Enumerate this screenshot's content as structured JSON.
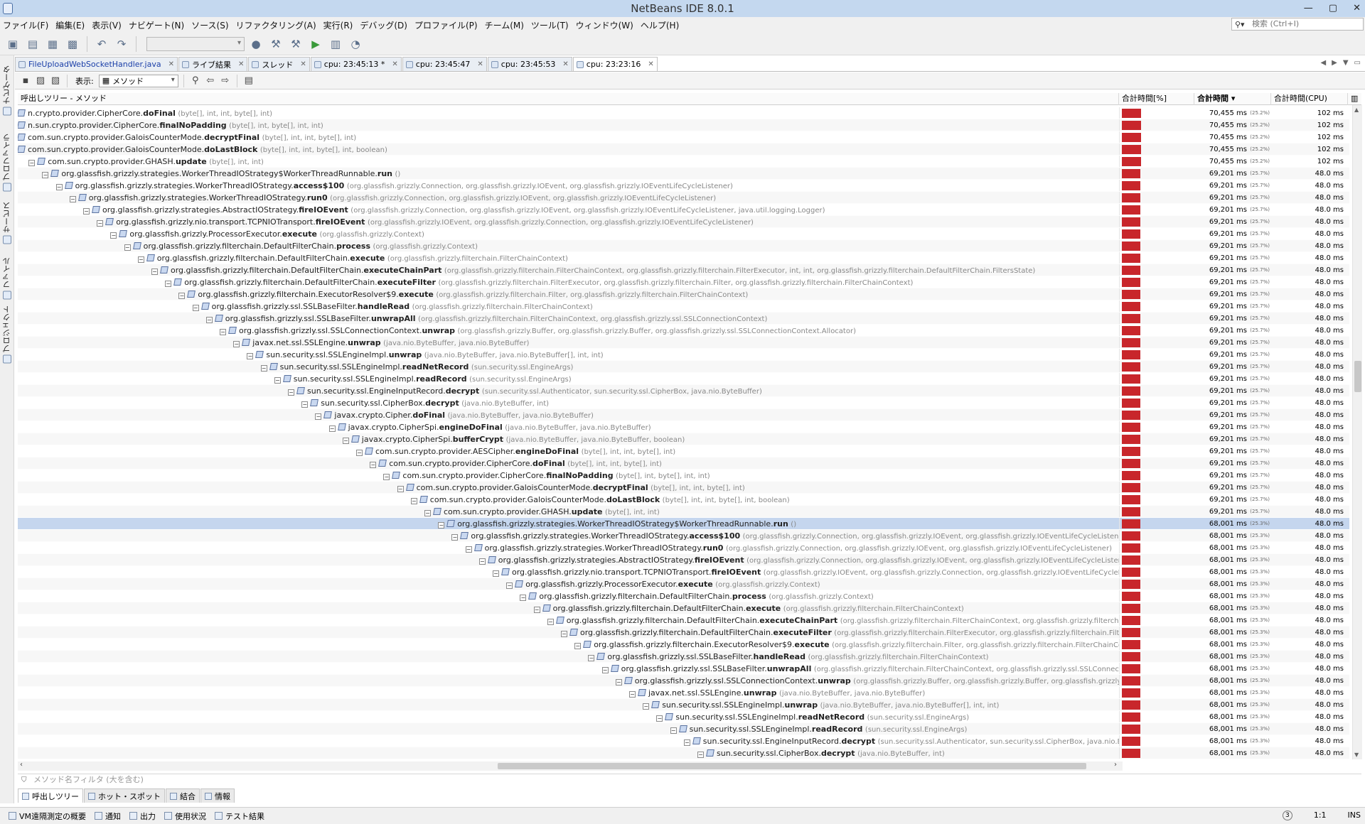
{
  "window": {
    "title": "NetBeans IDE 8.0.1",
    "controls": [
      "—",
      "▢",
      "✕"
    ]
  },
  "menu": [
    "ファイル(F)",
    "編集(E)",
    "表示(V)",
    "ナビゲート(N)",
    "ソース(S)",
    "リファクタリング(A)",
    "実行(R)",
    "デバッグ(D)",
    "プロファイル(P)",
    "チーム(M)",
    "ツール(T)",
    "ウィンドウ(W)",
    "ヘルプ(H)"
  ],
  "search": {
    "placeholder": "検索 (Ctrl+I)"
  },
  "left_sidebar": [
    "ナビゲータ",
    "プロファイラ",
    "サービス",
    "ファイル",
    "プロジェクト"
  ],
  "editor_tabs": [
    {
      "label": "FileUploadWebSocketHandler.java",
      "active": false
    },
    {
      "label": "ライブ結果",
      "active": false
    },
    {
      "label": "スレッド",
      "active": false
    },
    {
      "label": "cpu: 23:45:13 *",
      "active": false
    },
    {
      "label": "cpu: 23:45:47",
      "active": false
    },
    {
      "label": "cpu: 23:45:53",
      "active": false
    },
    {
      "label": "cpu: 23:23:16",
      "active": true
    }
  ],
  "profiler_toolbar": {
    "view_label": "表示:",
    "view_value": "メソッド"
  },
  "table": {
    "headers": [
      "呼出しツリー - メソッド",
      "合計時間[%]",
      "合計時間 ▾",
      "合計時間(CPU)"
    ],
    "rows": [
      {
        "depth": 0,
        "pre": "n.crypto.provider.CipherCore.",
        "m": "doFinal",
        "args": "(byte[], int, int, byte[], int)",
        "pct": 25.2,
        "time": "70,455 ms",
        "pctlabel": "(25.2%)",
        "cpu": "102 ms",
        "toggle": false
      },
      {
        "depth": 0,
        "pre": "n.sun.crypto.provider.CipherCore.",
        "m": "finalNoPadding",
        "args": "(byte[], int, byte[], int, int)",
        "pct": 25.2,
        "time": "70,455 ms",
        "pctlabel": "(25.2%)",
        "cpu": "102 ms",
        "toggle": false
      },
      {
        "depth": 0,
        "pre": "com.sun.crypto.provider.GaloisCounterMode.",
        "m": "decryptFinal",
        "args": "(byte[], int, int, byte[], int)",
        "pct": 25.2,
        "time": "70,455 ms",
        "pctlabel": "(25.2%)",
        "cpu": "102 ms",
        "toggle": false
      },
      {
        "depth": 0,
        "pre": "com.sun.crypto.provider.GaloisCounterMode.",
        "m": "doLastBlock",
        "args": "(byte[], int, int, byte[], int, boolean)",
        "pct": 25.2,
        "time": "70,455 ms",
        "pctlabel": "(25.2%)",
        "cpu": "102 ms",
        "toggle": false
      },
      {
        "depth": 1,
        "pre": "com.sun.crypto.provider.GHASH.",
        "m": "update",
        "args": "(byte[], int, int)",
        "pct": 25.2,
        "time": "70,455 ms",
        "pctlabel": "(25.2%)",
        "cpu": "102 ms",
        "toggle": true
      },
      {
        "depth": 2,
        "pre": "org.glassfish.grizzly.strategies.WorkerThreadIOStrategy$WorkerThreadRunnable.",
        "m": "run",
        "args": "()",
        "pct": 24.7,
        "time": "69,201 ms",
        "pctlabel": "(25.7%)",
        "cpu": "48.0 ms",
        "toggle": true
      },
      {
        "depth": 3,
        "pre": "org.glassfish.grizzly.strategies.WorkerThreadIOStrategy.",
        "m": "access$100",
        "args": "(org.glassfish.grizzly.Connection, org.glassfish.grizzly.IOEvent, org.glassfish.grizzly.IOEventLifeCycleListener)",
        "pct": 24.7,
        "time": "69,201 ms",
        "pctlabel": "(25.7%)",
        "cpu": "48.0 ms",
        "toggle": true
      },
      {
        "depth": 4,
        "pre": "org.glassfish.grizzly.strategies.WorkerThreadIOStrategy.",
        "m": "run0",
        "args": "(org.glassfish.grizzly.Connection, org.glassfish.grizzly.IOEvent, org.glassfish.grizzly.IOEventLifeCycleListener)",
        "pct": 24.7,
        "time": "69,201 ms",
        "pctlabel": "(25.7%)",
        "cpu": "48.0 ms",
        "toggle": true
      },
      {
        "depth": 5,
        "pre": "org.glassfish.grizzly.strategies.AbstractIOStrategy.",
        "m": "fireIOEvent",
        "args": "(org.glassfish.grizzly.Connection, org.glassfish.grizzly.IOEvent, org.glassfish.grizzly.IOEventLifeCycleListener, java.util.logging.Logger)",
        "pct": 24.7,
        "time": "69,201 ms",
        "pctlabel": "(25.7%)",
        "cpu": "48.0 ms",
        "toggle": true
      },
      {
        "depth": 6,
        "pre": "org.glassfish.grizzly.nio.transport.TCPNIOTransport.",
        "m": "fireIOEvent",
        "args": "(org.glassfish.grizzly.IOEvent, org.glassfish.grizzly.Connection, org.glassfish.grizzly.IOEventLifeCycleListener)",
        "pct": 24.7,
        "time": "69,201 ms",
        "pctlabel": "(25.7%)",
        "cpu": "48.0 ms",
        "toggle": true
      },
      {
        "depth": 7,
        "pre": "org.glassfish.grizzly.ProcessorExecutor.",
        "m": "execute",
        "args": "(org.glassfish.grizzly.Context)",
        "pct": 24.7,
        "time": "69,201 ms",
        "pctlabel": "(25.7%)",
        "cpu": "48.0 ms",
        "toggle": true
      },
      {
        "depth": 8,
        "pre": "org.glassfish.grizzly.filterchain.DefaultFilterChain.",
        "m": "process",
        "args": "(org.glassfish.grizzly.Context)",
        "pct": 24.7,
        "time": "69,201 ms",
        "pctlabel": "(25.7%)",
        "cpu": "48.0 ms",
        "toggle": true
      },
      {
        "depth": 9,
        "pre": "org.glassfish.grizzly.filterchain.DefaultFilterChain.",
        "m": "execute",
        "args": "(org.glassfish.grizzly.filterchain.FilterChainContext)",
        "pct": 24.7,
        "time": "69,201 ms",
        "pctlabel": "(25.7%)",
        "cpu": "48.0 ms",
        "toggle": true
      },
      {
        "depth": 10,
        "pre": "org.glassfish.grizzly.filterchain.DefaultFilterChain.",
        "m": "executeChainPart",
        "args": "(org.glassfish.grizzly.filterchain.FilterChainContext, org.glassfish.grizzly.filterchain.FilterExecutor, int, int, org.glassfish.grizzly.filterchain.DefaultFilterChain.FiltersState)",
        "pct": 24.7,
        "time": "69,201 ms",
        "pctlabel": "(25.7%)",
        "cpu": "48.0 ms",
        "toggle": true
      },
      {
        "depth": 11,
        "pre": "org.glassfish.grizzly.filterchain.DefaultFilterChain.",
        "m": "executeFilter",
        "args": "(org.glassfish.grizzly.filterchain.FilterExecutor, org.glassfish.grizzly.filterchain.Filter, org.glassfish.grizzly.filterchain.FilterChainContext)",
        "pct": 24.7,
        "time": "69,201 ms",
        "pctlabel": "(25.7%)",
        "cpu": "48.0 ms",
        "toggle": true
      },
      {
        "depth": 12,
        "pre": "org.glassfish.grizzly.filterchain.ExecutorResolver$9.",
        "m": "execute",
        "args": "(org.glassfish.grizzly.filterchain.Filter, org.glassfish.grizzly.filterchain.FilterChainContext)",
        "pct": 24.7,
        "time": "69,201 ms",
        "pctlabel": "(25.7%)",
        "cpu": "48.0 ms",
        "toggle": true
      },
      {
        "depth": 13,
        "pre": "org.glassfish.grizzly.ssl.SSLBaseFilter.",
        "m": "handleRead",
        "args": "(org.glassfish.grizzly.filterchain.FilterChainContext)",
        "pct": 24.7,
        "time": "69,201 ms",
        "pctlabel": "(25.7%)",
        "cpu": "48.0 ms",
        "toggle": true
      },
      {
        "depth": 14,
        "pre": "org.glassfish.grizzly.ssl.SSLBaseFilter.",
        "m": "unwrapAll",
        "args": "(org.glassfish.grizzly.filterchain.FilterChainContext, org.glassfish.grizzly.ssl.SSLConnectionContext)",
        "pct": 24.7,
        "time": "69,201 ms",
        "pctlabel": "(25.7%)",
        "cpu": "48.0 ms",
        "toggle": true
      },
      {
        "depth": 15,
        "pre": "org.glassfish.grizzly.ssl.SSLConnectionContext.",
        "m": "unwrap",
        "args": "(org.glassfish.grizzly.Buffer, org.glassfish.grizzly.Buffer, org.glassfish.grizzly.ssl.SSLConnectionContext.Allocator)",
        "pct": 24.7,
        "time": "69,201 ms",
        "pctlabel": "(25.7%)",
        "cpu": "48.0 ms",
        "toggle": true
      },
      {
        "depth": 16,
        "pre": "javax.net.ssl.SSLEngine.",
        "m": "unwrap",
        "args": "(java.nio.ByteBuffer, java.nio.ByteBuffer)",
        "pct": 24.7,
        "time": "69,201 ms",
        "pctlabel": "(25.7%)",
        "cpu": "48.0 ms",
        "toggle": true
      },
      {
        "depth": 17,
        "pre": "sun.security.ssl.SSLEngineImpl.",
        "m": "unwrap",
        "args": "(java.nio.ByteBuffer, java.nio.ByteBuffer[], int, int)",
        "pct": 24.7,
        "time": "69,201 ms",
        "pctlabel": "(25.7%)",
        "cpu": "48.0 ms",
        "toggle": true
      },
      {
        "depth": 18,
        "pre": "sun.security.ssl.SSLEngineImpl.",
        "m": "readNetRecord",
        "args": "(sun.security.ssl.EngineArgs)",
        "pct": 24.7,
        "time": "69,201 ms",
        "pctlabel": "(25.7%)",
        "cpu": "48.0 ms",
        "toggle": true
      },
      {
        "depth": 19,
        "pre": "sun.security.ssl.SSLEngineImpl.",
        "m": "readRecord",
        "args": "(sun.security.ssl.EngineArgs)",
        "pct": 24.7,
        "time": "69,201 ms",
        "pctlabel": "(25.7%)",
        "cpu": "48.0 ms",
        "toggle": true
      },
      {
        "depth": 20,
        "pre": "sun.security.ssl.EngineInputRecord.",
        "m": "decrypt",
        "args": "(sun.security.ssl.Authenticator, sun.security.ssl.CipherBox, java.nio.ByteBuffer)",
        "pct": 24.7,
        "time": "69,201 ms",
        "pctlabel": "(25.7%)",
        "cpu": "48.0 ms",
        "toggle": true
      },
      {
        "depth": 21,
        "pre": "sun.security.ssl.CipherBox.",
        "m": "decrypt",
        "args": "(java.nio.ByteBuffer, int)",
        "pct": 24.7,
        "time": "69,201 ms",
        "pctlabel": "(25.7%)",
        "cpu": "48.0 ms",
        "toggle": true
      },
      {
        "depth": 22,
        "pre": "javax.crypto.Cipher.",
        "m": "doFinal",
        "args": "(java.nio.ByteBuffer, java.nio.ByteBuffer)",
        "pct": 24.7,
        "time": "69,201 ms",
        "pctlabel": "(25.7%)",
        "cpu": "48.0 ms",
        "toggle": true
      },
      {
        "depth": 23,
        "pre": "javax.crypto.CipherSpi.",
        "m": "engineDoFinal",
        "args": "(java.nio.ByteBuffer, java.nio.ByteBuffer)",
        "pct": 24.7,
        "time": "69,201 ms",
        "pctlabel": "(25.7%)",
        "cpu": "48.0 ms",
        "toggle": true
      },
      {
        "depth": 24,
        "pre": "javax.crypto.CipherSpi.",
        "m": "bufferCrypt",
        "args": "(java.nio.ByteBuffer, java.nio.ByteBuffer, boolean)",
        "pct": 24.7,
        "time": "69,201 ms",
        "pctlabel": "(25.7%)",
        "cpu": "48.0 ms",
        "toggle": true
      },
      {
        "depth": 25,
        "pre": "com.sun.crypto.provider.AESCipher.",
        "m": "engineDoFinal",
        "args": "(byte[], int, int, byte[], int)",
        "pct": 24.7,
        "time": "69,201 ms",
        "pctlabel": "(25.7%)",
        "cpu": "48.0 ms",
        "toggle": true
      },
      {
        "depth": 26,
        "pre": "com.sun.crypto.provider.CipherCore.",
        "m": "doFinal",
        "args": "(byte[], int, int, byte[], int)",
        "pct": 24.7,
        "time": "69,201 ms",
        "pctlabel": "(25.7%)",
        "cpu": "48.0 ms",
        "toggle": true
      },
      {
        "depth": 27,
        "pre": "com.sun.crypto.provider.CipherCore.",
        "m": "finalNoPadding",
        "args": "(byte[], int, byte[], int, int)",
        "pct": 24.7,
        "time": "69,201 ms",
        "pctlabel": "(25.7%)",
        "cpu": "48.0 ms",
        "toggle": true
      },
      {
        "depth": 28,
        "pre": "com.sun.crypto.provider.GaloisCounterMode.",
        "m": "decryptFinal",
        "args": "(byte[], int, int, byte[], int)",
        "pct": 24.7,
        "time": "69,201 ms",
        "pctlabel": "(25.7%)",
        "cpu": "48.0 ms",
        "toggle": true
      },
      {
        "depth": 29,
        "pre": "com.sun.crypto.provider.GaloisCounterMode.",
        "m": "doLastBlock",
        "args": "(byte[], int, int, byte[], int, boolean)",
        "pct": 24.7,
        "time": "69,201 ms",
        "pctlabel": "(25.7%)",
        "cpu": "48.0 ms",
        "toggle": true
      },
      {
        "depth": 30,
        "pre": "com.sun.crypto.provider.GHASH.",
        "m": "update",
        "args": "(byte[], int, int)",
        "pct": 24.7,
        "time": "69,201 ms",
        "pctlabel": "(25.7%)",
        "cpu": "48.0 ms",
        "toggle": true
      },
      {
        "depth": 31,
        "pre": "org.glassfish.grizzly.strategies.WorkerThreadIOStrategy$WorkerThreadRunnable.",
        "m": "run",
        "args": "()",
        "pct": 24.3,
        "time": "68,001 ms",
        "pctlabel": "(25.3%)",
        "cpu": "48.0 ms",
        "toggle": true,
        "selected": true
      },
      {
        "depth": 32,
        "pre": "org.glassfish.grizzly.strategies.WorkerThreadIOStrategy.",
        "m": "access$100",
        "args": "(org.glassfish.grizzly.Connection, org.glassfish.grizzly.IOEvent, org.glassfish.grizzly.IOEventLifeCycleListener)",
        "pct": 24.3,
        "time": "68,001 ms",
        "pctlabel": "(25.3%)",
        "cpu": "48.0 ms",
        "toggle": true
      },
      {
        "depth": 33,
        "pre": "org.glassfish.grizzly.strategies.WorkerThreadIOStrategy.",
        "m": "run0",
        "args": "(org.glassfish.grizzly.Connection, org.glassfish.grizzly.IOEvent, org.glassfish.grizzly.IOEventLifeCycleListener)",
        "pct": 24.3,
        "time": "68,001 ms",
        "pctlabel": "(25.3%)",
        "cpu": "48.0 ms",
        "toggle": true
      },
      {
        "depth": 34,
        "pre": "org.glassfish.grizzly.strategies.AbstractIOStrategy.",
        "m": "fireIOEvent",
        "args": "(org.glassfish.grizzly.Connection, org.glassfish.grizzly.IOEvent, org.glassfish.grizzly.IOEventLifeCycleListener, j",
        "pct": 24.3,
        "time": "68,001 ms",
        "pctlabel": "(25.3%)",
        "cpu": "48.0 ms",
        "toggle": true
      },
      {
        "depth": 35,
        "pre": "org.glassfish.grizzly.nio.transport.TCPNIOTransport.",
        "m": "fireIOEvent",
        "args": "(org.glassfish.grizzly.IOEvent, org.glassfish.grizzly.Connection, org.glassfish.grizzly.IOEventLifeCycleListene",
        "pct": 24.3,
        "time": "68,001 ms",
        "pctlabel": "(25.3%)",
        "cpu": "48.0 ms",
        "toggle": true
      },
      {
        "depth": 36,
        "pre": "org.glassfish.grizzly.ProcessorExecutor.",
        "m": "execute",
        "args": "(org.glassfish.grizzly.Context)",
        "pct": 24.3,
        "time": "68,001 ms",
        "pctlabel": "(25.3%)",
        "cpu": "48.0 ms",
        "toggle": true
      },
      {
        "depth": 37,
        "pre": "org.glassfish.grizzly.filterchain.DefaultFilterChain.",
        "m": "process",
        "args": "(org.glassfish.grizzly.Context)",
        "pct": 24.3,
        "time": "68,001 ms",
        "pctlabel": "(25.3%)",
        "cpu": "48.0 ms",
        "toggle": true
      },
      {
        "depth": 38,
        "pre": "org.glassfish.grizzly.filterchain.DefaultFilterChain.",
        "m": "execute",
        "args": "(org.glassfish.grizzly.filterchain.FilterChainContext)",
        "pct": 24.3,
        "time": "68,001 ms",
        "pctlabel": "(25.3%)",
        "cpu": "48.0 ms",
        "toggle": true
      },
      {
        "depth": 39,
        "pre": "org.glassfish.grizzly.filterchain.DefaultFilterChain.",
        "m": "executeChainPart",
        "args": "(org.glassfish.grizzly.filterchain.FilterChainContext, org.glassfish.grizzly.filterchain.Filt",
        "pct": 24.3,
        "time": "68,001 ms",
        "pctlabel": "(25.3%)",
        "cpu": "48.0 ms",
        "toggle": true
      },
      {
        "depth": 40,
        "pre": "org.glassfish.grizzly.filterchain.DefaultFilterChain.",
        "m": "executeFilter",
        "args": "(org.glassfish.grizzly.filterchain.FilterExecutor, org.glassfish.grizzly.filterchain.Filter, org",
        "pct": 24.3,
        "time": "68,001 ms",
        "pctlabel": "(25.3%)",
        "cpu": "48.0 ms",
        "toggle": true
      },
      {
        "depth": 41,
        "pre": "org.glassfish.grizzly.filterchain.ExecutorResolver$9.",
        "m": "execute",
        "args": "(org.glassfish.grizzly.filterchain.Filter, org.glassfish.grizzly.filterchain.FilterChainContext",
        "pct": 24.3,
        "time": "68,001 ms",
        "pctlabel": "(25.3%)",
        "cpu": "48.0 ms",
        "toggle": true
      },
      {
        "depth": 42,
        "pre": "org.glassfish.grizzly.ssl.SSLBaseFilter.",
        "m": "handleRead",
        "args": "(org.glassfish.grizzly.filterchain.FilterChainContext)",
        "pct": 24.3,
        "time": "68,001 ms",
        "pctlabel": "(25.3%)",
        "cpu": "48.0 ms",
        "toggle": true
      },
      {
        "depth": 43,
        "pre": "org.glassfish.grizzly.ssl.SSLBaseFilter.",
        "m": "unwrapAll",
        "args": "(org.glassfish.grizzly.filterchain.FilterChainContext, org.glassfish.grizzly.ssl.SSLConnection",
        "pct": 24.3,
        "time": "68,001 ms",
        "pctlabel": "(25.3%)",
        "cpu": "48.0 ms",
        "toggle": true
      },
      {
        "depth": 44,
        "pre": "org.glassfish.grizzly.ssl.SSLConnectionContext.",
        "m": "unwrap",
        "args": "(org.glassfish.grizzly.Buffer, org.glassfish.grizzly.Buffer, org.glassfish.grizzly.ss",
        "pct": 24.3,
        "time": "68,001 ms",
        "pctlabel": "(25.3%)",
        "cpu": "48.0 ms",
        "toggle": true
      },
      {
        "depth": 45,
        "pre": "javax.net.ssl.SSLEngine.",
        "m": "unwrap",
        "args": "(java.nio.ByteBuffer, java.nio.ByteBuffer)",
        "pct": 24.3,
        "time": "68,001 ms",
        "pctlabel": "(25.3%)",
        "cpu": "48.0 ms",
        "toggle": true
      },
      {
        "depth": 46,
        "pre": "sun.security.ssl.SSLEngineImpl.",
        "m": "unwrap",
        "args": "(java.nio.ByteBuffer, java.nio.ByteBuffer[], int, int)",
        "pct": 24.3,
        "time": "68,001 ms",
        "pctlabel": "(25.3%)",
        "cpu": "48.0 ms",
        "toggle": true
      },
      {
        "depth": 47,
        "pre": "sun.security.ssl.SSLEngineImpl.",
        "m": "readNetRecord",
        "args": "(sun.security.ssl.EngineArgs)",
        "pct": 24.3,
        "time": "68,001 ms",
        "pctlabel": "(25.3%)",
        "cpu": "48.0 ms",
        "toggle": true
      },
      {
        "depth": 48,
        "pre": "sun.security.ssl.SSLEngineImpl.",
        "m": "readRecord",
        "args": "(sun.security.ssl.EngineArgs)",
        "pct": 24.3,
        "time": "68,001 ms",
        "pctlabel": "(25.3%)",
        "cpu": "48.0 ms",
        "toggle": true
      },
      {
        "depth": 49,
        "pre": "sun.security.ssl.EngineInputRecord.",
        "m": "decrypt",
        "args": "(sun.security.ssl.Authenticator, sun.security.ssl.CipherBox, java.nio.ByteBu",
        "pct": 24.3,
        "time": "68,001 ms",
        "pctlabel": "(25.3%)",
        "cpu": "48.0 ms",
        "toggle": true
      },
      {
        "depth": 50,
        "pre": "sun.security.ssl.CipherBox.",
        "m": "decrypt",
        "args": "(java.nio.ByteBuffer, int)",
        "pct": 24.3,
        "time": "68,001 ms",
        "pctlabel": "(25.3%)",
        "cpu": "48.0 ms",
        "toggle": true
      }
    ]
  },
  "filter": {
    "placeholder": "メソッド名フィルタ (大を含む)"
  },
  "bottom_tabs": [
    {
      "label": "呼出しツリー",
      "active": true
    },
    {
      "label": "ホット・スポット",
      "active": false
    },
    {
      "label": "結合",
      "active": false
    },
    {
      "label": "情報",
      "active": false
    }
  ],
  "status_bar": {
    "tabs": [
      "VM遠隔測定の概要",
      "通知",
      "出力",
      "使用状況",
      "テスト結果"
    ],
    "badge": "3",
    "position": "1:1",
    "mode": "INS"
  },
  "colors": {
    "bar": "#c8262b",
    "selection": "#c5d6ee",
    "titlebar": "#c4d8ef"
  }
}
